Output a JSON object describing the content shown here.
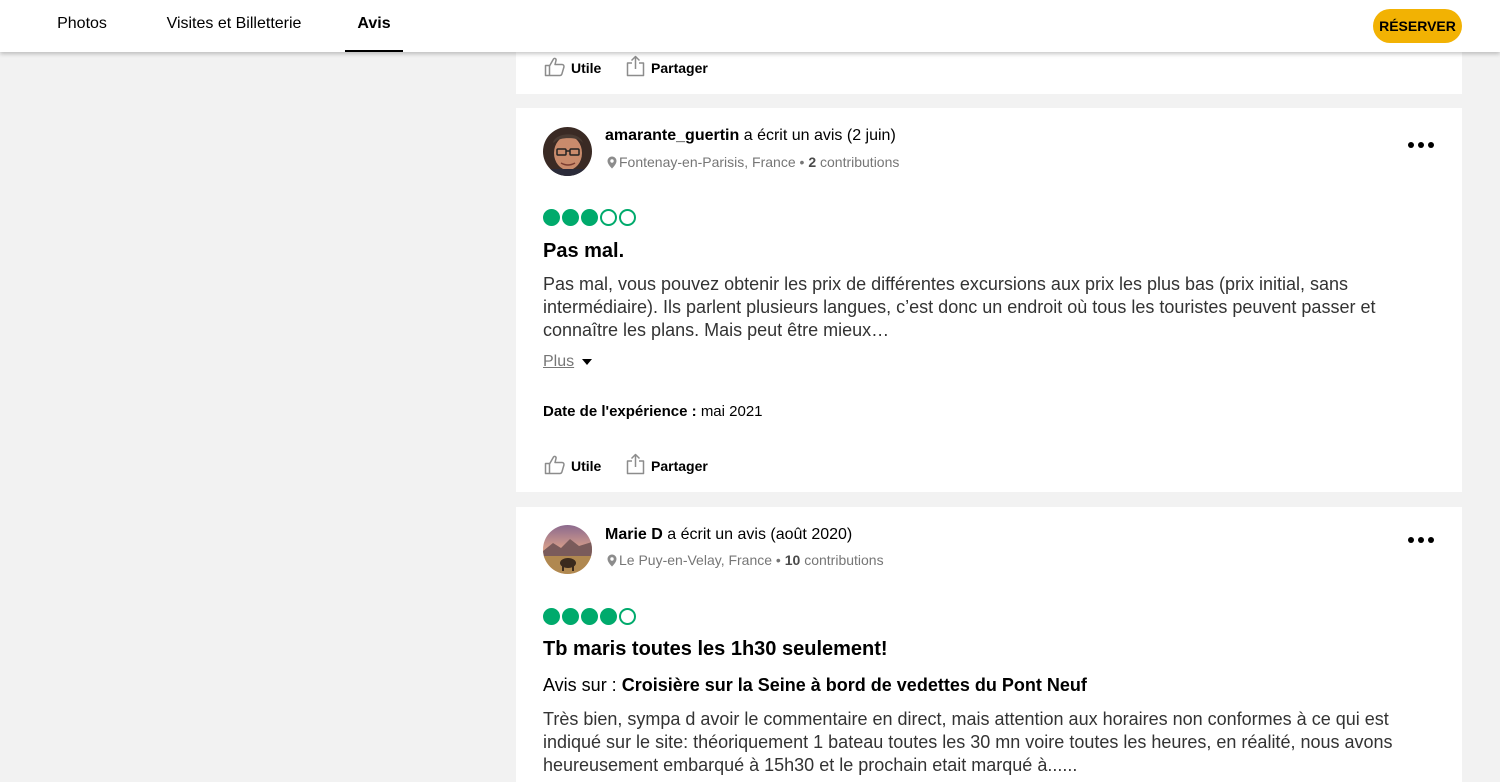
{
  "nav": {
    "tabs": [
      {
        "label": "Photos"
      },
      {
        "label": "Visites et Billetterie"
      },
      {
        "label": "Avis"
      }
    ],
    "reserve_label": "RÉSERVER"
  },
  "actions": {
    "helpful": "Utile",
    "share": "Partager"
  },
  "reviews": [
    {
      "author": "amarante_guertin",
      "wrote": "a écrit un avis (2 juin)",
      "location": "Fontenay-en-Parisis, France •",
      "contributions_count": "2",
      "contributions_label": "contributions",
      "rating": 3,
      "rating_max": 5,
      "title": "Pas mal.",
      "body": "Pas mal, vous pouvez obtenir les prix de différentes excursions aux prix les plus bas (prix initial, sans intermédiaire). Ils parlent plusieurs langues, c’est donc un endroit où tous les touristes peuvent passer et connaître les plans. Mais peut être mieux…",
      "more_label": "Plus",
      "experience_label": "Date de l'expérience :",
      "experience_value": "mai 2021"
    },
    {
      "author": "Marie D",
      "wrote": "a écrit un avis (août 2020)",
      "location": "Le Puy-en-Velay, France •",
      "contributions_count": "10",
      "contributions_label": "contributions",
      "rating": 4,
      "rating_max": 5,
      "title": "Tb maris toutes les 1h30 seulement!",
      "about_label": "Avis sur :",
      "about_value": "Croisière sur la Seine à bord de vedettes du Pont Neuf",
      "body": "Très bien, sympa d avoir le commentaire en direct, mais attention aux horaires non conformes à ce qui est indiqué sur le site: théoriquement 1 bateau toutes les 30 mn voire toutes les heures, en réalité, nous avons heureusement embarqué à 15h30 et le prochain etait marqué à......"
    }
  ],
  "colors": {
    "bubble": "#00aa6c",
    "reserve": "#f2b203",
    "background": "#f2f2f2"
  }
}
